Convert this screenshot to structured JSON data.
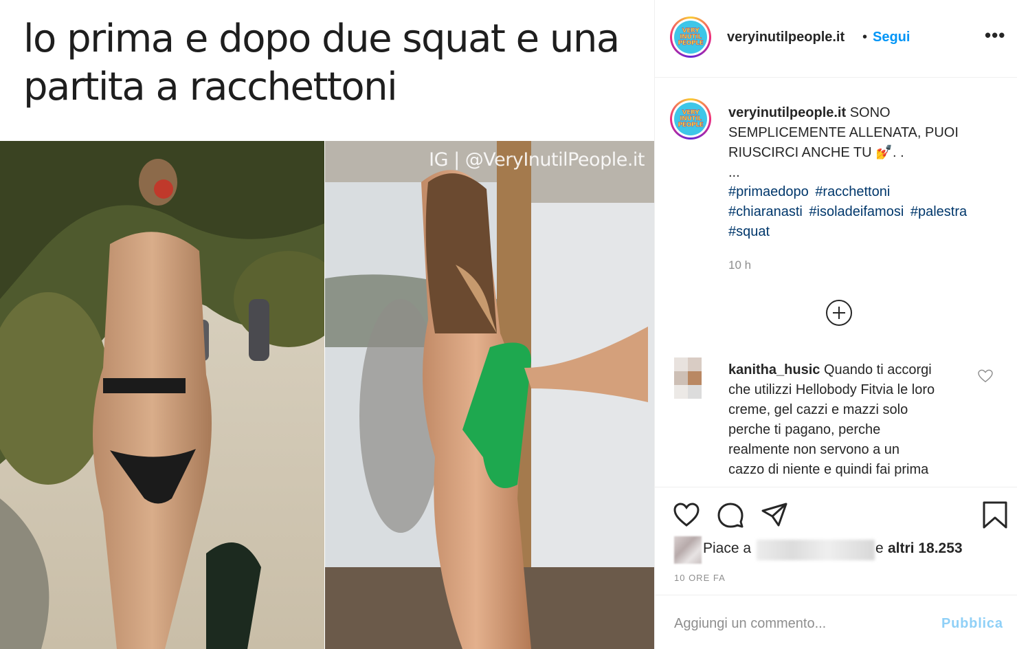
{
  "meme": {
    "caption_line1": "lo prima e dopo due squat e una",
    "caption_line2": "partita a racchettoni",
    "watermark": "IG | @VeryInutilPeople.it"
  },
  "header": {
    "avatar_logo": [
      "VERY",
      "INUTIL",
      "PEOPLE"
    ],
    "username": "veryinutilpeople.it",
    "separator": "•",
    "follow_label": "Segui",
    "more_label": "•••"
  },
  "caption": {
    "username": "veryinutilpeople.it",
    "text_line1": " SONO",
    "text_line2": "SEMPLICEMENTE ALLENATA, PUOI",
    "text_line3": "RIUSCIRCI ANCHE TU 💅. .",
    "text_line4": "...",
    "hashtags": [
      "#primaedopo",
      "#racchettoni",
      "#chiaranasti",
      "#isoladeifamosi",
      "#palestra",
      "#squat"
    ],
    "time": "10 h"
  },
  "comment": {
    "username": "kanitha_husic",
    "lines": [
      " Quando ti accorgi",
      "che utilizzi Hellobody Fitvia le loro",
      "creme, gel cazzi e mazzi solo",
      "perche ti pagano, perche",
      "realmente non servono a un",
      "cazzo di niente e quindi fai prima"
    ]
  },
  "likes": {
    "prefix": "Piace a",
    "conjunction": "e",
    "rest": "altri 18.253"
  },
  "post_time": "10 ORE FA",
  "add_comment": {
    "placeholder": "Aggiungi un commento...",
    "publish_label": "Pubblica"
  },
  "icons": [
    "heart-icon",
    "comment-icon",
    "share-icon",
    "bookmark-icon",
    "more-icon",
    "plus-circle-icon"
  ],
  "colors": {
    "link": "#00376b",
    "follow": "#0095f6",
    "publish_disabled": "#8fd0f7",
    "muted": "#8e8e8e"
  }
}
